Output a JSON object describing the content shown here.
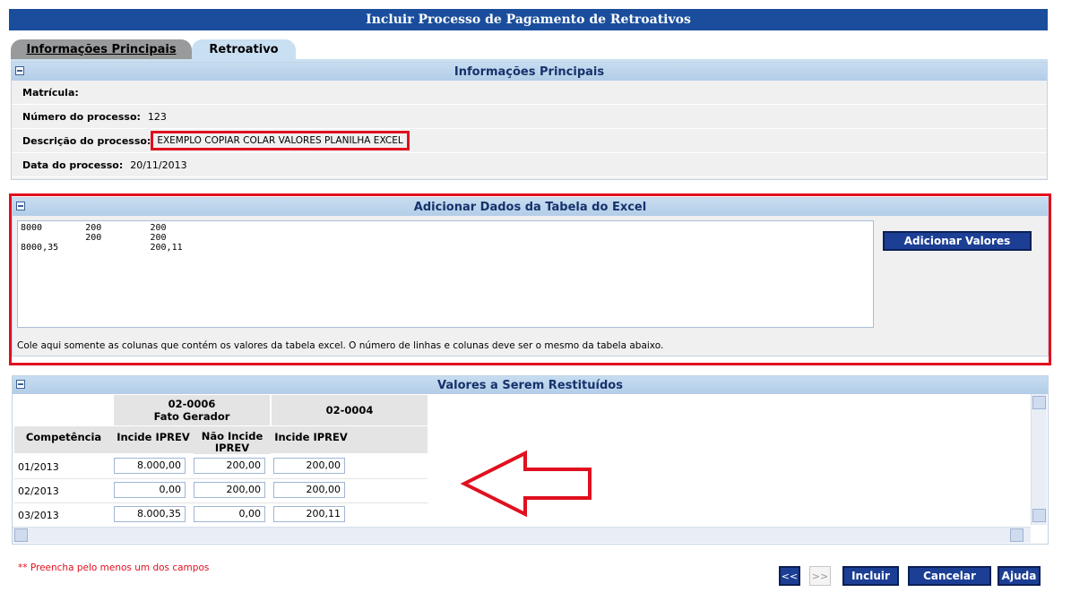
{
  "title": "Incluir Processo de Pagamento de Retroativos",
  "tabs": [
    {
      "label": "Informações Principais"
    },
    {
      "label": "Retroativo"
    }
  ],
  "info_panel": {
    "header": "Informações Principais",
    "fields": [
      {
        "label": "Matrícula:",
        "value": ""
      },
      {
        "label": "Número do processo:",
        "value": "123"
      },
      {
        "label": "Descrição do processo:",
        "value": "EXEMPLO COPIAR COLAR VALORES PLANILHA EXCEL"
      },
      {
        "label": "Data do processo:",
        "value": "20/11/2013"
      }
    ]
  },
  "excel_panel": {
    "header": "Adicionar Dados da Tabela do Excel",
    "paste_content": "8000        200         200\n            200         200\n8000,35                 200,11",
    "add_button": "Adicionar Valores",
    "hint": "Cole aqui somente as colunas que contém os valores da tabela excel. O número de linhas e colunas deve ser o mesmo da tabela abaixo."
  },
  "values_panel": {
    "header": "Valores a Serem Restituídos",
    "group_headers": [
      {
        "code": "02-0006",
        "sub": "Fato Gerador"
      },
      {
        "code": "02-0004",
        "sub": ""
      }
    ],
    "columns": [
      "Competência",
      "Incide IPREV",
      "Não Incide IPREV",
      "Incide IPREV"
    ],
    "rows": [
      {
        "competencia": "01/2013",
        "v1": "8.000,00",
        "v2": "200,00",
        "v3": "200,00"
      },
      {
        "competencia": "02/2013",
        "v1": "0,00",
        "v2": "200,00",
        "v3": "200,00"
      },
      {
        "competencia": "03/2013",
        "v1": "8.000,35",
        "v2": "0,00",
        "v3": "200,11"
      }
    ]
  },
  "footer": {
    "required_note": "** Preencha pelo menos um dos campos",
    "prev_label": "<<",
    "next_label": ">>",
    "incluir": "Incluir",
    "cancelar": "Cancelar",
    "ajuda": "Ajuda"
  },
  "colors": {
    "title_bar": "#1a4e9c",
    "panel_header": "#c7dcf0",
    "highlight": "#e0101f",
    "button": "#1c3f95"
  }
}
